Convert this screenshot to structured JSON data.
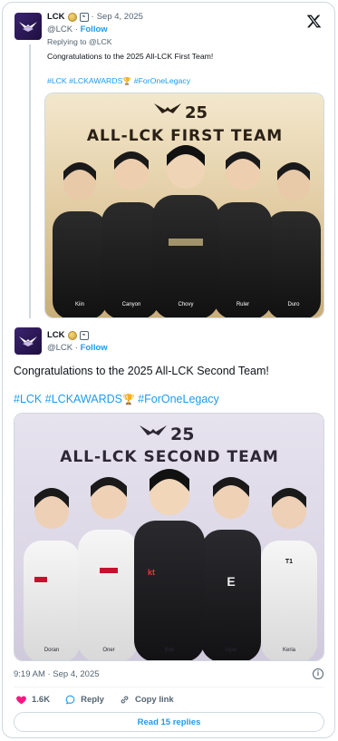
{
  "quoted_tweet": {
    "author_name": "LCK",
    "handle": "@LCK",
    "separator": "·",
    "date": "Sep 4, 2025",
    "follow_label": "Follow",
    "replying_to": "Replying to @LCK",
    "text": "Congratulations to the 2025 All-LCK First Team!",
    "hashtags": [
      "#LCK",
      "#LCKAWARDS",
      "#ForOneLegacy"
    ],
    "image": {
      "logo_text": "25",
      "title": "ALL-LCK FIRST TEAM",
      "players": [
        "Kiin",
        "Canyon",
        "Chovy",
        "Ruler",
        "Duro"
      ]
    }
  },
  "main_tweet": {
    "author_name": "LCK",
    "handle": "@LCK",
    "separator": "·",
    "follow_label": "Follow",
    "text": "Congratulations to the 2025 All-LCK Second Team!",
    "hashtags": [
      "#LCK",
      "#LCKAWARDS",
      "#ForOneLegacy"
    ],
    "image": {
      "logo_text": "25",
      "title": "ALL-LCK SECOND TEAM",
      "players": [
        "Doran",
        "Oner",
        "Bdd",
        "Viper",
        "Keria"
      ]
    },
    "timestamp": "9:19 AM · Sep 4, 2025",
    "likes": "1.6K",
    "reply_label": "Reply",
    "copy_link_label": "Copy link",
    "read_replies_label": "Read 15 replies"
  },
  "colors": {
    "accent": "#1d9bf0",
    "like": "#f91880",
    "border": "#cfd9de",
    "muted": "#536471"
  },
  "icons": [
    "x-logo-icon",
    "lck-avatar-icon",
    "verified-gold-icon",
    "affiliate-badge-icon",
    "trophy-icon",
    "info-icon",
    "heart-icon",
    "reply-icon",
    "link-icon"
  ]
}
